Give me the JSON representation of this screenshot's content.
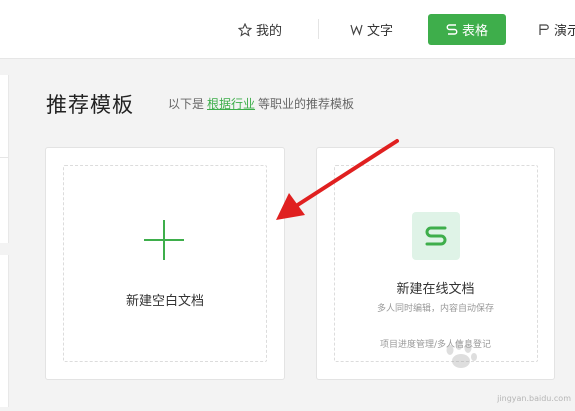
{
  "nav": {
    "mine": {
      "label": "我的",
      "icon": "star-icon"
    },
    "doc": {
      "label": "文字",
      "icon": "w-doc-icon"
    },
    "sheet": {
      "label": "表格",
      "icon": "s-sheet-icon",
      "active": true
    },
    "slides": {
      "label": "演示",
      "icon": "p-slides-icon"
    }
  },
  "section": {
    "title": "推荐模板",
    "sub_prefix": "以下是",
    "sub_link": "根据行业",
    "sub_suffix": "等职业的推荐模板"
  },
  "cards": {
    "blank": {
      "label": "新建空白文档",
      "icon": "plus-icon"
    },
    "online": {
      "title": "新建在线文档",
      "desc": "多人同时编辑，内容自动保存",
      "tags": "项目进度管理/多人信息登记",
      "icon": "s-sheet-icon"
    }
  },
  "watermark": {
    "text": "jingyan.baidu.com"
  },
  "colors": {
    "accent": "#3eae4b",
    "sheet_icon_bg": "#dff3e7",
    "annotation": "#e02020"
  }
}
